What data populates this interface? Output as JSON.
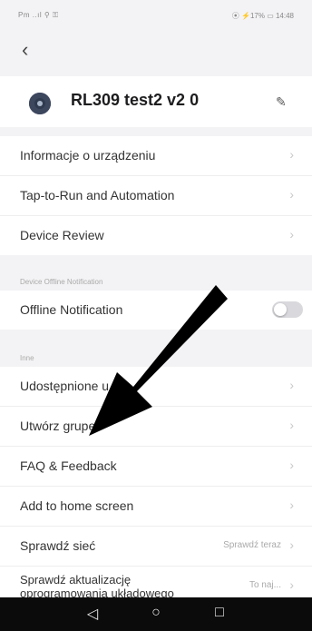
{
  "status": {
    "left": "Pm ..ıl ⚲ ⚿",
    "right": "⦿ ⚡17% ▭ 14:48"
  },
  "nav": {
    "back_icon": "back-arrow-icon"
  },
  "device": {
    "name": "RL309 test2 v2 0",
    "edit_icon": "pencil-icon"
  },
  "section_main": {
    "items": [
      {
        "label": "Informacje o urządzeniu"
      },
      {
        "label": "Tap-to-Run and Automation"
      },
      {
        "label": "Device Review"
      }
    ]
  },
  "offline": {
    "caption": "Device Offline Notification",
    "label": "Offline Notification",
    "toggle_on": false
  },
  "other": {
    "caption": "Inne",
    "items": [
      {
        "label": "Udostępnione u"
      },
      {
        "label": "Utwórz grupę"
      },
      {
        "label": "FAQ & Feedback"
      },
      {
        "label": "Add to home screen"
      },
      {
        "label": "Sprawdź sieć",
        "value": "Sprawdź teraz"
      },
      {
        "label": "Sprawdź aktualizację oprogramowania układowego",
        "value": "To naj..."
      }
    ]
  },
  "navbar": {
    "back": "◁",
    "home": "○",
    "recents": "□"
  },
  "colors": {
    "background": "#f3f3f5",
    "arrow": "#000000",
    "navbar": "#0b0b0b"
  }
}
